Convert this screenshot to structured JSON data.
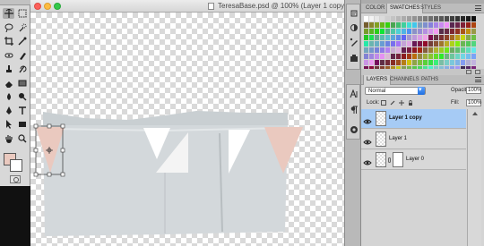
{
  "document": {
    "title": "TeresaBase.psd @ 100% (Layer 1 copy",
    "window_controls": [
      "close",
      "minimize",
      "zoom"
    ]
  },
  "tools": {
    "items": [
      "move-icon",
      "marquee-icon",
      "lasso-icon",
      "quick-select-icon",
      "crop-icon",
      "eyedropper-icon",
      "healing-brush-icon",
      "brush-icon",
      "clone-stamp-icon",
      "history-brush-icon",
      "eraser-icon",
      "gradient-icon",
      "blur-icon",
      "dodge-icon",
      "pen-icon",
      "type-icon",
      "path-select-icon",
      "shape-icon",
      "hand-icon",
      "zoom-icon"
    ],
    "active_tool": "move-icon",
    "foreground_color": "#eac9bf",
    "background_color": "#ffffff"
  },
  "swatches_panel": {
    "tabs": [
      "COLOR",
      "SWATCHES",
      "STYLES"
    ],
    "active_tab": "SWATCHES"
  },
  "layers_panel": {
    "tabs": [
      "LAYERS",
      "CHANNELS",
      "PATHS"
    ],
    "active_tab": "LAYERS",
    "blend_mode": "Normal",
    "opacity_label": "Opacity:",
    "opacity_value": "100%",
    "lock_label": "Lock:",
    "fill_label": "Fill:",
    "fill_value": "100%",
    "layers": [
      {
        "name": "Layer 1 copy",
        "visible": true,
        "selected": true,
        "has_mask": false
      },
      {
        "name": "Layer 1",
        "visible": true,
        "selected": false,
        "has_mask": false
      },
      {
        "name": "Layer 0",
        "visible": true,
        "selected": false,
        "has_mask": true
      }
    ]
  },
  "colors": {
    "selection": "#a6cbf5",
    "skirt": "#cfd4d7",
    "skin_patch": "#eac9bf",
    "panel": "#d4d4d4"
  }
}
